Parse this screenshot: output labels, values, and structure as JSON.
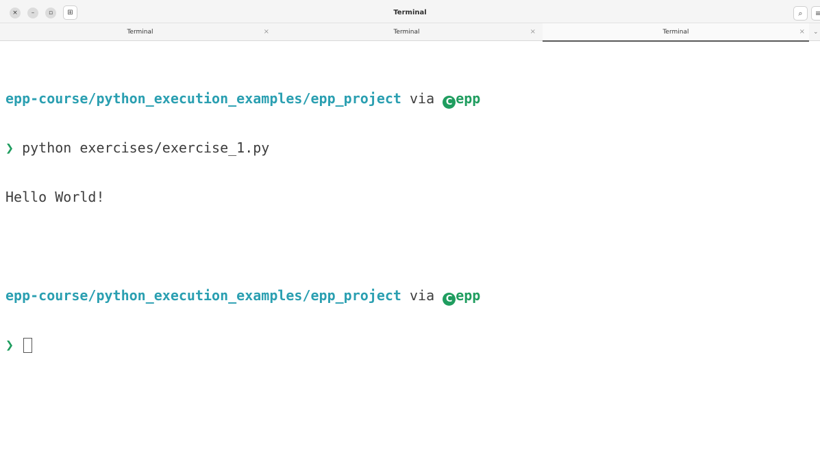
{
  "window": {
    "title": "Terminal",
    "controls": {
      "close": "×",
      "minimize": "–",
      "maximize": "▫",
      "new_tab": "⊞"
    },
    "toolbar": {
      "search": "⌕",
      "menu": "≡"
    }
  },
  "tabs": [
    {
      "label": "Terminal",
      "close": "×",
      "active": false
    },
    {
      "label": "Terminal",
      "close": "×",
      "active": false
    },
    {
      "label": "Terminal",
      "close": "×",
      "active": true
    }
  ],
  "tabs_overflow": "⌄",
  "terminal": {
    "prompt1": {
      "path": "epp-course/python_execution_examples/epp_project",
      "via": " via ",
      "env_icon": "C",
      "env": "epp"
    },
    "command1": {
      "chevron": "❯",
      "text": " python exercises/exercise_1.py"
    },
    "output1": "Hello World!",
    "prompt2": {
      "path": "epp-course/python_execution_examples/epp_project",
      "via": " via ",
      "env_icon": "C",
      "env": "epp"
    },
    "command2": {
      "chevron": "❯"
    }
  },
  "colors": {
    "path": "#2a9fb1",
    "env": "#1f9d5f",
    "text": "#3d3d3d"
  }
}
